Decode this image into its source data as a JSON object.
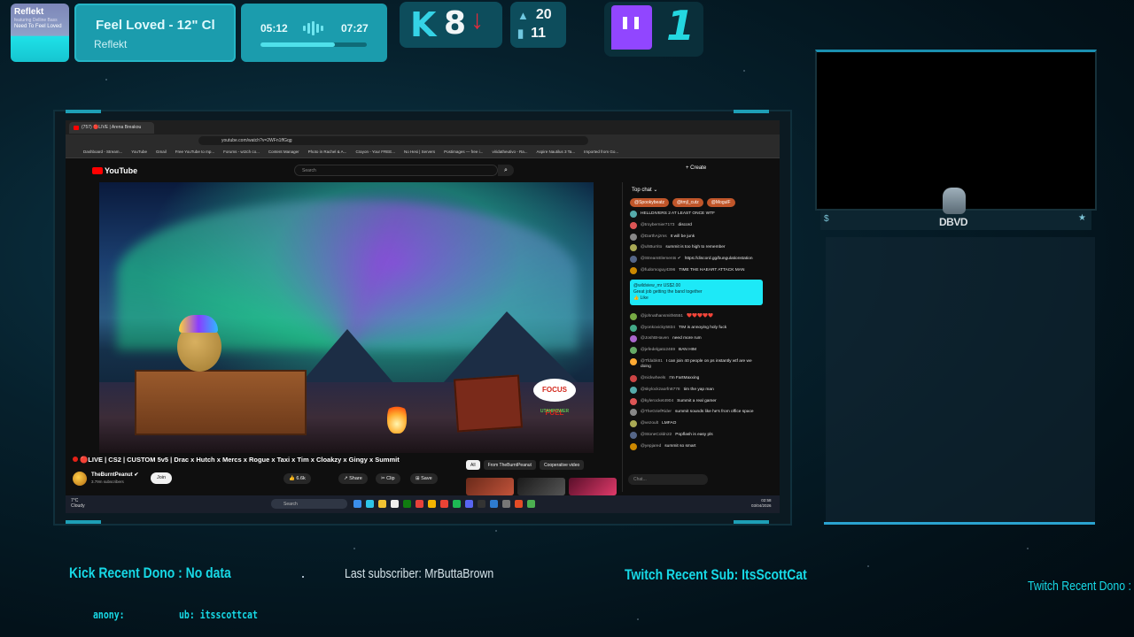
{
  "now_playing": {
    "thumb_title": "Reflekt",
    "thumb_subtitle": "featuring Delline Bass",
    "thumb_track": "Need To Feel Loved",
    "song": "Feel Loved - 12\" Cl",
    "artist": "Reflekt",
    "elapsed": "05:12",
    "duration": "07:27",
    "progress": 0.7
  },
  "kick": {
    "logo": "K",
    "count": "8",
    "arrow": "↓"
  },
  "stats": {
    "top_value": "20",
    "bottom_value": "11"
  },
  "twitch": {
    "count": "1"
  },
  "browser": {
    "tab_title": "(757) 🔴LIVE | Arena Breakou",
    "url": "youtube.com/watch?v=2WFn1ffGqg",
    "bookmarks": [
      "Dashboard - Stream...",
      "YouTube",
      "Gmail",
      "Free YouTube to mp...",
      "Forums - w1tch co...",
      "Content Manager",
      "Photo in Rachel & A...",
      "Crayon - Your FREE...",
      "No Hesi | Servers",
      "Postimages — free i...",
      "viridatheutivo - Ra...",
      "Aspire Nautilus 3 Ta...",
      "Imported from Go..."
    ]
  },
  "youtube": {
    "logo": "YouTube",
    "search_placeholder": "Search",
    "create_label": "+ Create",
    "video_title": "🔴LIVE | CS2 | CUSTOM 5v5 | Drac x Hutch x Mercs x Rogue x Taxi x Tim x Cloakzy x Gingy x Summit",
    "channel": "TheBurntPeanut ✔",
    "subscribers": "3.79m subscribers",
    "join": "Join",
    "likes": "👍 6.6k",
    "share": "↗ Share",
    "clip": "✂ Clip",
    "save": "⊞ Save",
    "chips": [
      "All",
      "From TheBurntPeanut",
      "Cooperative video"
    ],
    "focus_fuel": "FOCUS FUEL",
    "sponsor": "UTAHPOWER"
  },
  "chat": {
    "header": "Top chat ⌄",
    "sticky": [
      "@Spookybeatz",
      "@tmjl_cutz",
      "@MogulF"
    ],
    "messages": [
      {
        "user": "",
        "text": "HELLDIVERS 2 AT LEAST ONCE WTF"
      },
      {
        "user": "@troybernier7173",
        "text": "discord"
      },
      {
        "user": "@DarthAjzms",
        "text": "It will be junk"
      },
      {
        "user": "@uhBurrito",
        "text": "summit is too high to remember"
      },
      {
        "user": "@StreamElements ✔",
        "text": "https://discord.gg/bungulationstation"
      },
      {
        "user": "@fudomoguy4396",
        "text": "TIME THE HAEART ATTACK MAN"
      }
    ],
    "superchat": {
      "user": "@wildview_mr",
      "amount": "US$2.00",
      "text": "Great job getting the band together",
      "like": "Like"
    },
    "messages2": [
      {
        "user": "@johnathansmith6551",
        "text": "❤️❤️❤️❤️❤️"
      },
      {
        "user": "@yonkovicky5834",
        "text": "TIM is annoying holy fuck"
      },
      {
        "user": "@JoshBHaven",
        "text": "need more rum"
      },
      {
        "user": "@jefedelgato2469",
        "text": "BAN HIM"
      },
      {
        "user": "@Tfdabk81",
        "text": "I can join 40 people on ps instantly wtf are we doing"
      },
      {
        "user": "@nickwheels",
        "text": "I'm FartMaxxing"
      },
      {
        "user": "@skylockzaorfn8778",
        "text": "tim the yap man"
      },
      {
        "user": "@kylerocket4904",
        "text": "Summit a real gamer"
      },
      {
        "user": "@TheGriefRider",
        "text": "summit sounds like he's from office space"
      },
      {
        "user": "@vezoult",
        "text": "LMFAO"
      },
      {
        "user": "@StoneColdn22",
        "text": "Popflash is easy pls"
      },
      {
        "user": "@yepjared",
        "text": "summit so smart"
      }
    ],
    "input_placeholder": "Chat..."
  },
  "taskbar": {
    "weather_temp": "7°C",
    "weather_desc": "Cloudy",
    "search": "Search",
    "time": "02:58",
    "date": "03/04/2026"
  },
  "branding": {
    "logo_text": "DBVD"
  },
  "tickers": {
    "kick_dono": "Kick Recent Dono : No data",
    "last_sub": "Last subscriber: MrButtaBrown",
    "twitch_sub": "Twitch Recent Sub: ItsScottCat",
    "twitch_dono": "Twitch Recent Dono : a",
    "anon": "anony:",
    "sub_small": "ub: itsscottcat"
  },
  "colors": {
    "accent": "#17d9e6",
    "kick": "#35d3e6",
    "twitch": "#9146ff",
    "youtube_red": "#ff0000"
  }
}
